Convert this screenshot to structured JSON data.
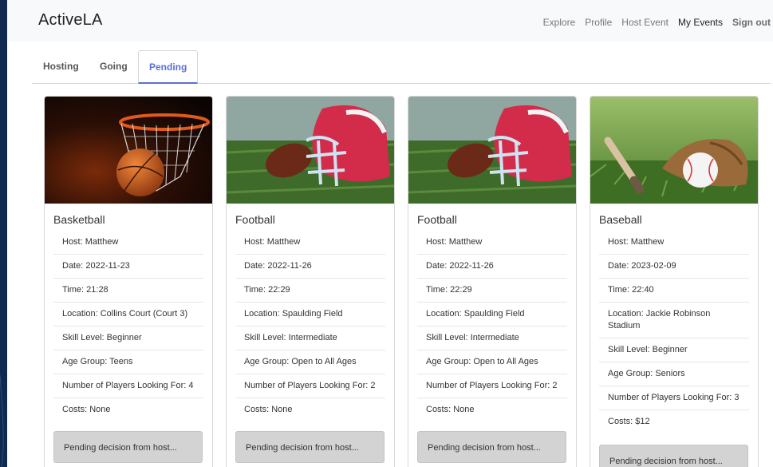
{
  "nav": {
    "brand": "ActiveLA",
    "links": [
      {
        "label": "Explore"
      },
      {
        "label": "Profile"
      },
      {
        "label": "Host Event"
      },
      {
        "label": "My Events"
      },
      {
        "label": "Sign out"
      }
    ]
  },
  "tabs": [
    {
      "label": "Hosting"
    },
    {
      "label": "Going"
    },
    {
      "label": "Pending"
    }
  ],
  "cards": [
    {
      "title": "Basketball",
      "image": "basketball-hoop",
      "host": "Host: Matthew",
      "date": "Date: 2022-11-23",
      "time": "Time: 21:28",
      "location": "Location: Collins Court (Court 3)",
      "skill": "Skill Level: Beginner",
      "age": "Age Group: Teens",
      "players": "Number of Players Looking For: 4",
      "costs": "Costs: None",
      "status": "Pending decision from host..."
    },
    {
      "title": "Football",
      "image": "football-helmet",
      "host": "Host: Matthew",
      "date": "Date: 2022-11-26",
      "time": "Time: 22:29",
      "location": "Location: Spaulding Field",
      "skill": "Skill Level: Intermediate",
      "age": "Age Group: Open to All Ages",
      "players": "Number of Players Looking For: 2",
      "costs": "Costs: None",
      "status": "Pending decision from host..."
    },
    {
      "title": "Football",
      "image": "football-helmet",
      "host": "Host: Matthew",
      "date": "Date: 2022-11-26",
      "time": "Time: 22:29",
      "location": "Location: Spaulding Field",
      "skill": "Skill Level: Intermediate",
      "age": "Age Group: Open to All Ages",
      "players": "Number of Players Looking For: 2",
      "costs": "Costs: None",
      "status": "Pending decision from host..."
    },
    {
      "title": "Baseball",
      "image": "baseball-glove",
      "host": "Host: Matthew",
      "date": "Date: 2023-02-09",
      "time": "Time: 22:40",
      "location": "Location: Jackie Robinson Stadium",
      "skill": "Skill Level: Beginner",
      "age": "Age Group: Seniors",
      "players": "Number of Players Looking For: 3",
      "costs": "Costs: $12",
      "status": "Pending decision from host..."
    }
  ],
  "colors": {
    "accent": "#5a6fd6",
    "background": "#0e2a4f",
    "button": "#d3d3d3"
  }
}
